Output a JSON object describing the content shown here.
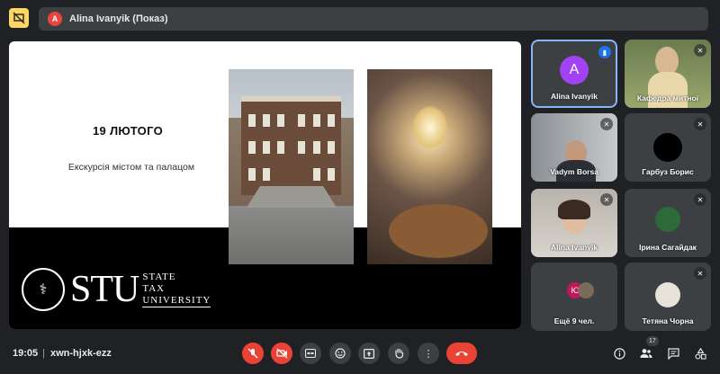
{
  "topbar": {
    "presenter_initial": "A",
    "presenter_label": "Alina Ivanyik (Показ)"
  },
  "slide": {
    "date": "19 ЛЮТОГО",
    "subtitle": "Екскурсія містом та палацом",
    "logo_text": "STU",
    "logo_line1": "STATE",
    "logo_line2": "TAX",
    "logo_line3": "UNIVERSITY"
  },
  "participants": [
    {
      "name": "Alina Ivanyik",
      "initial": "A",
      "avatar_color": "#a142f4",
      "speaking": true
    },
    {
      "name": "Кафедра митної",
      "muted": true
    },
    {
      "name": "Vadym Borsa",
      "muted": true
    },
    {
      "name": "Гарбуз Борис",
      "muted": true
    },
    {
      "name": "Alina Ivanyik",
      "muted": true
    },
    {
      "name": "Ірина Сагайдак",
      "muted": true
    },
    {
      "name": "Ещё 9 чел.",
      "initial": "Ю"
    },
    {
      "name": "Тетяна Чорна",
      "muted": true
    }
  ],
  "bottombar": {
    "time": "19:05",
    "separator": "|",
    "meeting_code": "xwn-hjxk-ezz",
    "participant_count": "17"
  },
  "colors": {
    "background": "#202124",
    "tile": "#3c4043",
    "danger": "#ea4335",
    "highlight": "#8ab4f8",
    "present_icon": "#fdd663"
  }
}
